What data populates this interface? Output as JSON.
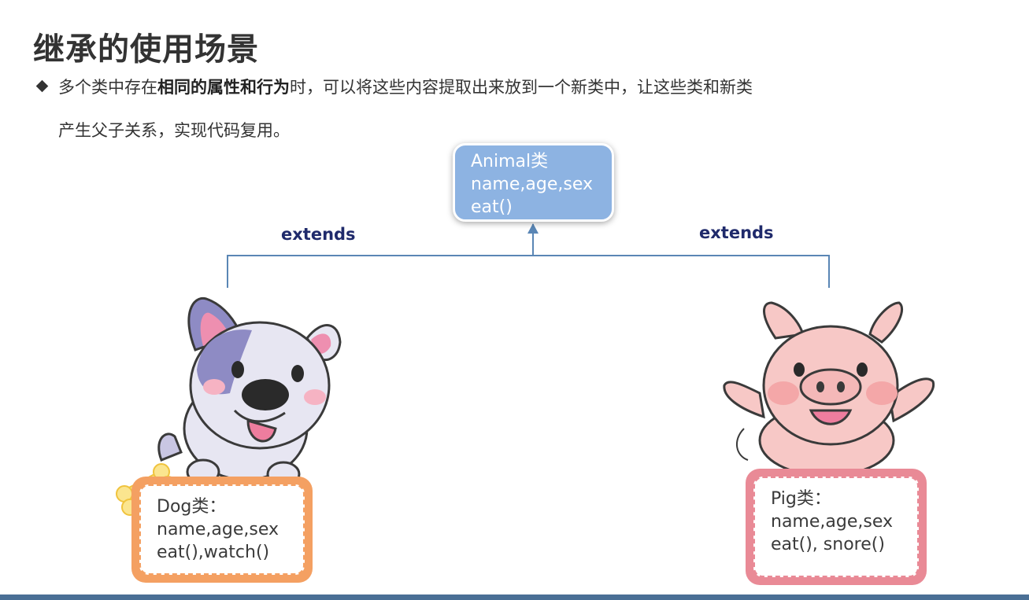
{
  "title": "继承的使用场景",
  "bullet": {
    "part1": "多个类中存在",
    "part2_bold": "相同的属性和行为",
    "part3": "时，可以将这些内容提取出来放到一个新类中，让这些类和新类",
    "part4": "产生父子关系，实现代码复用。"
  },
  "parent_class": {
    "lines": [
      "Animal类",
      "name,age,sex",
      "eat()"
    ]
  },
  "extends_left": "extends",
  "extends_right": "extends",
  "dog_class": {
    "lines": [
      "Dog类：",
      "name,age,sex",
      "eat(),watch()"
    ]
  },
  "pig_class": {
    "lines": [
      "Pig类：",
      "name,age,sex",
      "eat(), snore()"
    ]
  },
  "colors": {
    "parent_box": "#8db3e2",
    "connector": "#5a86b5",
    "dog_card": "#f4a062",
    "pig_card": "#e98a96"
  }
}
